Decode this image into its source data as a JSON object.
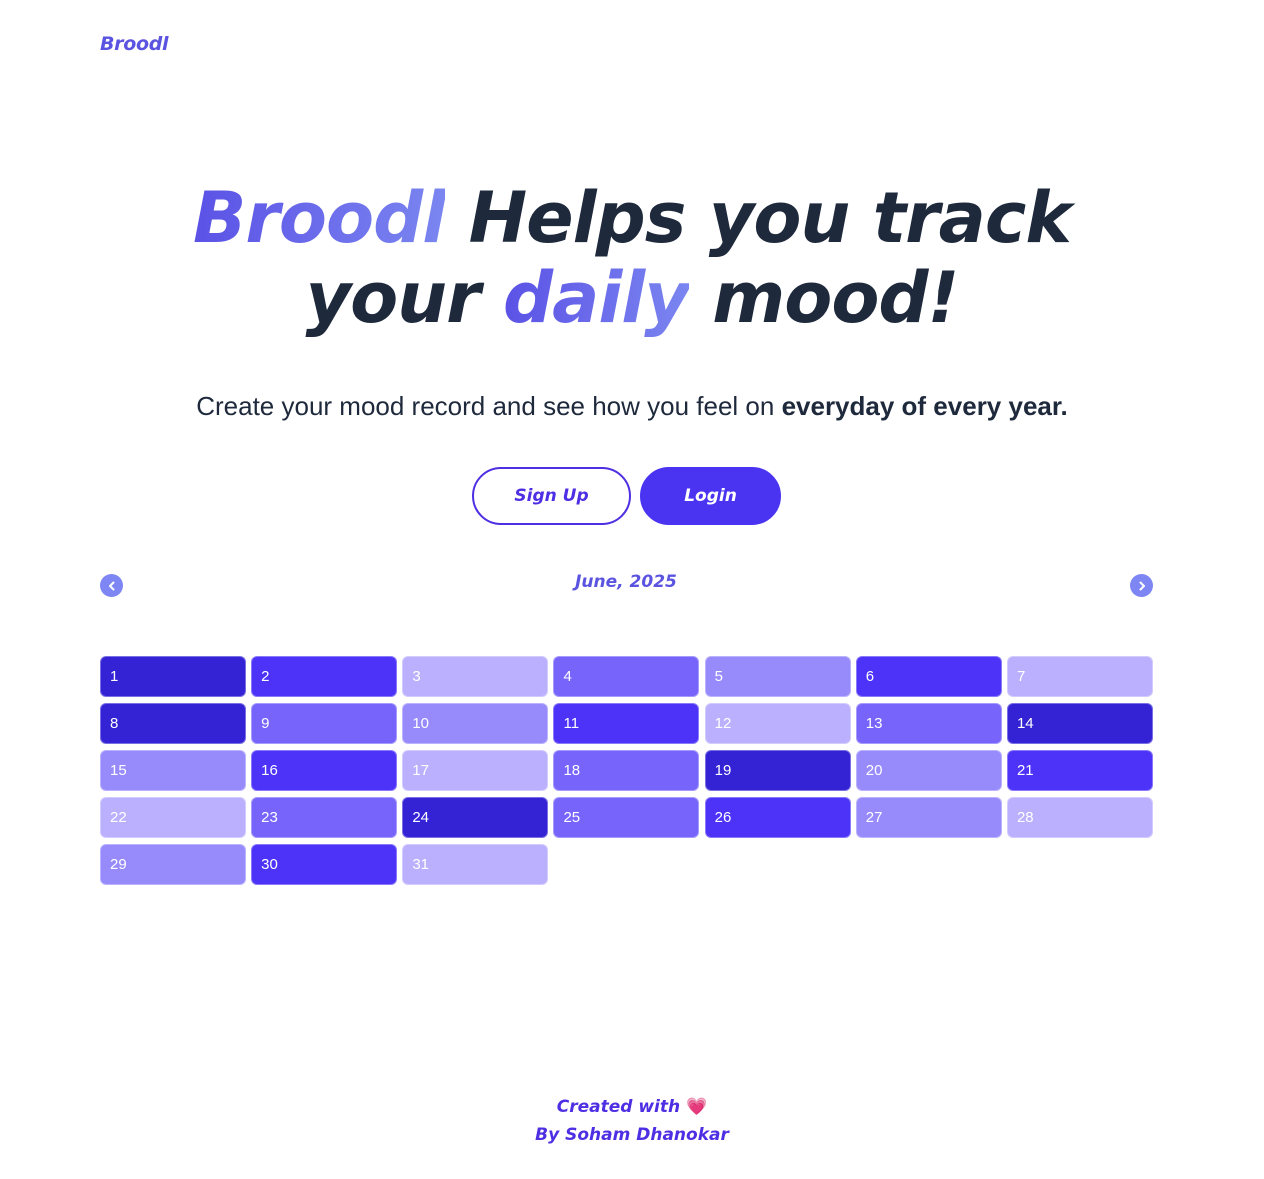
{
  "header": {
    "brand": "Broodl"
  },
  "hero": {
    "title_brand": "Broodl",
    "title_part1": " Helps you track",
    "title_part2": "your ",
    "title_highlight": "daily",
    "title_part3": " mood!",
    "subtitle_plain": "Create your mood record and see how you feel on ",
    "subtitle_bold": "everyday of every year."
  },
  "actions": {
    "signup_label": "Sign Up",
    "login_label": "Login"
  },
  "calendar": {
    "month_label": "June, 2025",
    "prev_icon": "chevron-left-icon",
    "next_icon": "chevron-right-icon",
    "mood_colors": [
      "#bbb0fd",
      "#978bfc",
      "#7765fb",
      "#4c33f7",
      "#3423d4"
    ],
    "days": [
      {
        "label": "1",
        "mood": 5
      },
      {
        "label": "2",
        "mood": 4
      },
      {
        "label": "3",
        "mood": 1
      },
      {
        "label": "4",
        "mood": 3
      },
      {
        "label": "5",
        "mood": 2
      },
      {
        "label": "6",
        "mood": 4
      },
      {
        "label": "7",
        "mood": 1
      },
      {
        "label": "8",
        "mood": 5
      },
      {
        "label": "9",
        "mood": 3
      },
      {
        "label": "10",
        "mood": 2
      },
      {
        "label": "11",
        "mood": 4
      },
      {
        "label": "12",
        "mood": 1
      },
      {
        "label": "13",
        "mood": 3
      },
      {
        "label": "14",
        "mood": 5
      },
      {
        "label": "15",
        "mood": 2
      },
      {
        "label": "16",
        "mood": 4
      },
      {
        "label": "17",
        "mood": 1
      },
      {
        "label": "18",
        "mood": 3
      },
      {
        "label": "19",
        "mood": 5
      },
      {
        "label": "20",
        "mood": 2
      },
      {
        "label": "21",
        "mood": 4
      },
      {
        "label": "22",
        "mood": 1
      },
      {
        "label": "23",
        "mood": 3
      },
      {
        "label": "24",
        "mood": 5
      },
      {
        "label": "25",
        "mood": 3
      },
      {
        "label": "26",
        "mood": 4
      },
      {
        "label": "27",
        "mood": 2
      },
      {
        "label": "28",
        "mood": 1
      },
      {
        "label": "29",
        "mood": 2
      },
      {
        "label": "30",
        "mood": 4
      },
      {
        "label": "31",
        "mood": 1
      }
    ]
  },
  "footer": {
    "line1": "Created with",
    "heart": "💗",
    "line2": "By Soham Dhanokar"
  }
}
